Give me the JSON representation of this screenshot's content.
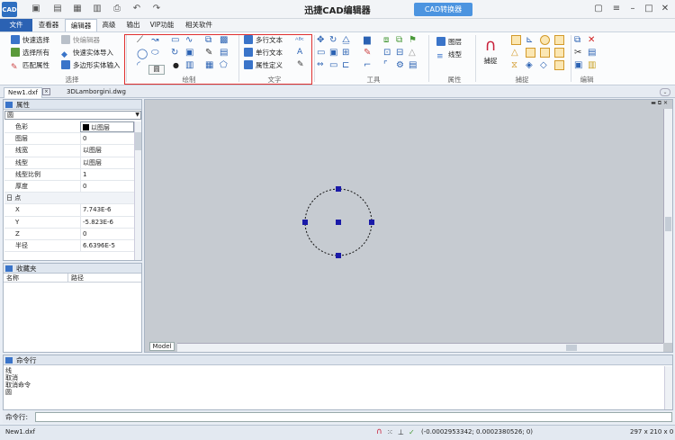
{
  "app": {
    "title": "迅捷CAD编辑器",
    "converter_label": "CAD转换器",
    "logo": "CAD"
  },
  "colors": {
    "accent": "#2b62b3",
    "canvas": "#c6cbd1",
    "highlight": "#e03030",
    "grip": "#1a1aa8"
  },
  "tabs": [
    "文件",
    "查看器",
    "编辑器",
    "高级",
    "输出",
    "VIP功能",
    "相关软件"
  ],
  "ribbon": {
    "select": {
      "items": [
        "快速选择",
        "选择所有",
        "匹配属性"
      ],
      "items2": [
        "快编辑器",
        "快速实体导入",
        "多边形实体输入"
      ],
      "label": "选择"
    },
    "draw": {
      "label": "绘制",
      "tooltip": "圆"
    },
    "text": {
      "items": [
        "多行文本",
        "单行文本",
        "属性定义"
      ],
      "label": "文字"
    },
    "tools": {
      "label": "工具"
    },
    "props": {
      "items": [
        "图层",
        "线型"
      ],
      "label": "属性"
    },
    "snap": {
      "button": "捕捉",
      "label": "捕捉"
    },
    "edit": {
      "label": "编辑"
    }
  },
  "doc_tabs": [
    "New1.dxf",
    "3DLamborgini.dwg"
  ],
  "properties": {
    "title": "属性",
    "object": "圆",
    "rows": [
      {
        "k": "色彩",
        "v": "以图层"
      },
      {
        "k": "图层",
        "v": "0"
      },
      {
        "k": "线宽",
        "v": "以图层"
      },
      {
        "k": "线型",
        "v": "以图层"
      },
      {
        "k": "线型比例",
        "v": "1"
      },
      {
        "k": "厚度",
        "v": "0"
      },
      {
        "k": "日 点",
        "v": "",
        "cat": true
      },
      {
        "k": "X",
        "v": "7.743E-6"
      },
      {
        "k": "Y",
        "v": "-5.823E-6"
      },
      {
        "k": "Z",
        "v": "0"
      },
      {
        "k": "半径",
        "v": "6.6396E-5"
      }
    ]
  },
  "favorites": {
    "title": "收藏夹",
    "col_name": "名称",
    "col_path": "路径"
  },
  "model_tab": "Model",
  "command": {
    "title": "命令行",
    "lines": [
      "线",
      "取消",
      "取消命令",
      "圆"
    ],
    "input_label": "命令行:"
  },
  "status": {
    "file": "New1.dxf",
    "coords": "(-0.0002953342; 0.0002380526; 0)",
    "size": "297 x 210 x 0"
  }
}
